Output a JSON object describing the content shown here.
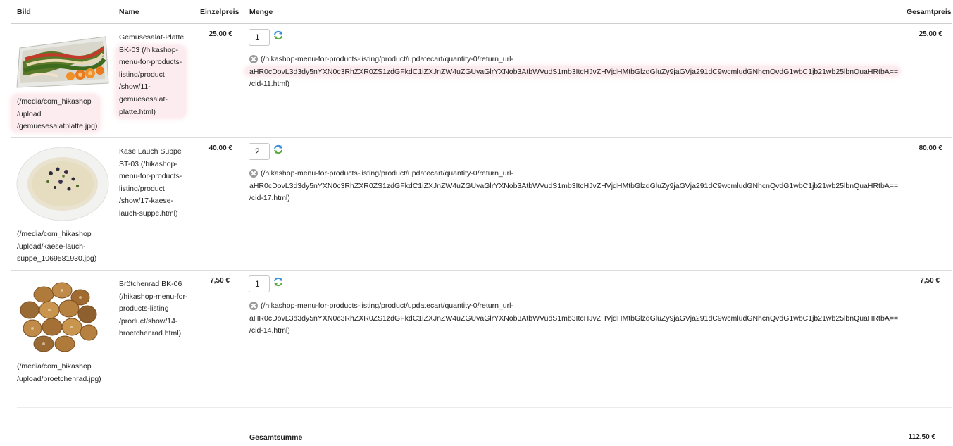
{
  "headers": {
    "bild": "Bild",
    "name": "Name",
    "einzelpreis": "Einzelpreis",
    "menge": "Menge",
    "gesamtpreis": "Gesamtpreis"
  },
  "rows": [
    {
      "image_link": [
        "(/media/com_hikashop",
        "/upload",
        "/gemuesesalatplatte.jpg)"
      ],
      "name": [
        "Gemüsesalat-Platte",
        "BK-03 (/hikashop-",
        "menu-for-products-",
        "listing/product",
        "/show/11-",
        "gemuesesalat-",
        "platte.html)"
      ],
      "unit_price": "25,00 €",
      "quantity": "1",
      "remove_link": [
        "(/hikashop-menu-for-products-listing/product/updatecart/quantity-0/return_url-",
        "aHR0cDovL3d3dy5nYXN0c3RhZXR0ZS1zdGFkdC1iZXJnZW4uZGUvaGlrYXNob3AtbWVudS1mb3ItcHJvZHVjdHMtbGlzdGluZy9jaGVja291dC9wcmludGNhcnQvdG1wbC1jb21wb25lbnQuaHRtbA==",
        "/cid-11.html)"
      ],
      "total_price": "25,00 €"
    },
    {
      "image_link": [
        "(/media/com_hikashop",
        "/upload/kaese-lauch-",
        "suppe_1069581930.jpg)"
      ],
      "name": [
        "Käse Lauch Suppe",
        "ST-03 (/hikashop-",
        "menu-for-products-",
        "listing/product",
        "/show/17-kaese-",
        "lauch-suppe.html)"
      ],
      "unit_price": "40,00 €",
      "quantity": "2",
      "remove_link": [
        "(/hikashop-menu-for-products-listing/product/updatecart/quantity-0/return_url-",
        "aHR0cDovL3d3dy5nYXN0c3RhZXR0ZS1zdGFkdC1iZXJnZW4uZGUvaGlrYXNob3AtbWVudS1mb3ItcHJvZHVjdHMtbGlzdGluZy9jaGVja291dC9wcmludGNhcnQvdG1wbC1jb21wb25lbnQuaHRtbA==",
        "/cid-17.html)"
      ],
      "total_price": "80,00 €"
    },
    {
      "image_link": [
        "(/media/com_hikashop",
        "/upload/broetchenrad.jpg)"
      ],
      "name": [
        "Brötchenrad BK-06",
        "(/hikashop-menu-for-",
        "products-listing",
        "/product/show/14-",
        "broetchenrad.html)"
      ],
      "unit_price": "7,50 €",
      "quantity": "1",
      "remove_link": [
        "(/hikashop-menu-for-products-listing/product/updatecart/quantity-0/return_url-",
        "aHR0cDovL3d3dy5nYXN0c3RhZXR0ZS1zdGFkdC1iZXJnZW4uZGUvaGlrYXNob3AtbWVudS1mb3ItcHJvZHVjdHMtbGlzdGluZy9jaGVja291dC9wcmludGNhcnQvdG1wbC1jb21wb25lbnQuaHRtbA==",
        "/cid-14.html)"
      ],
      "total_price": "7,50 €"
    }
  ],
  "footer": {
    "total_label": "Gesamtsumme",
    "total_value": "112,50 €"
  },
  "icons": {
    "refresh": "refresh-icon",
    "remove": "remove-icon"
  },
  "colors": {
    "highlight": "#f096aa",
    "refresh_blue": "#3a8fd8",
    "refresh_green": "#5aaa3c"
  }
}
